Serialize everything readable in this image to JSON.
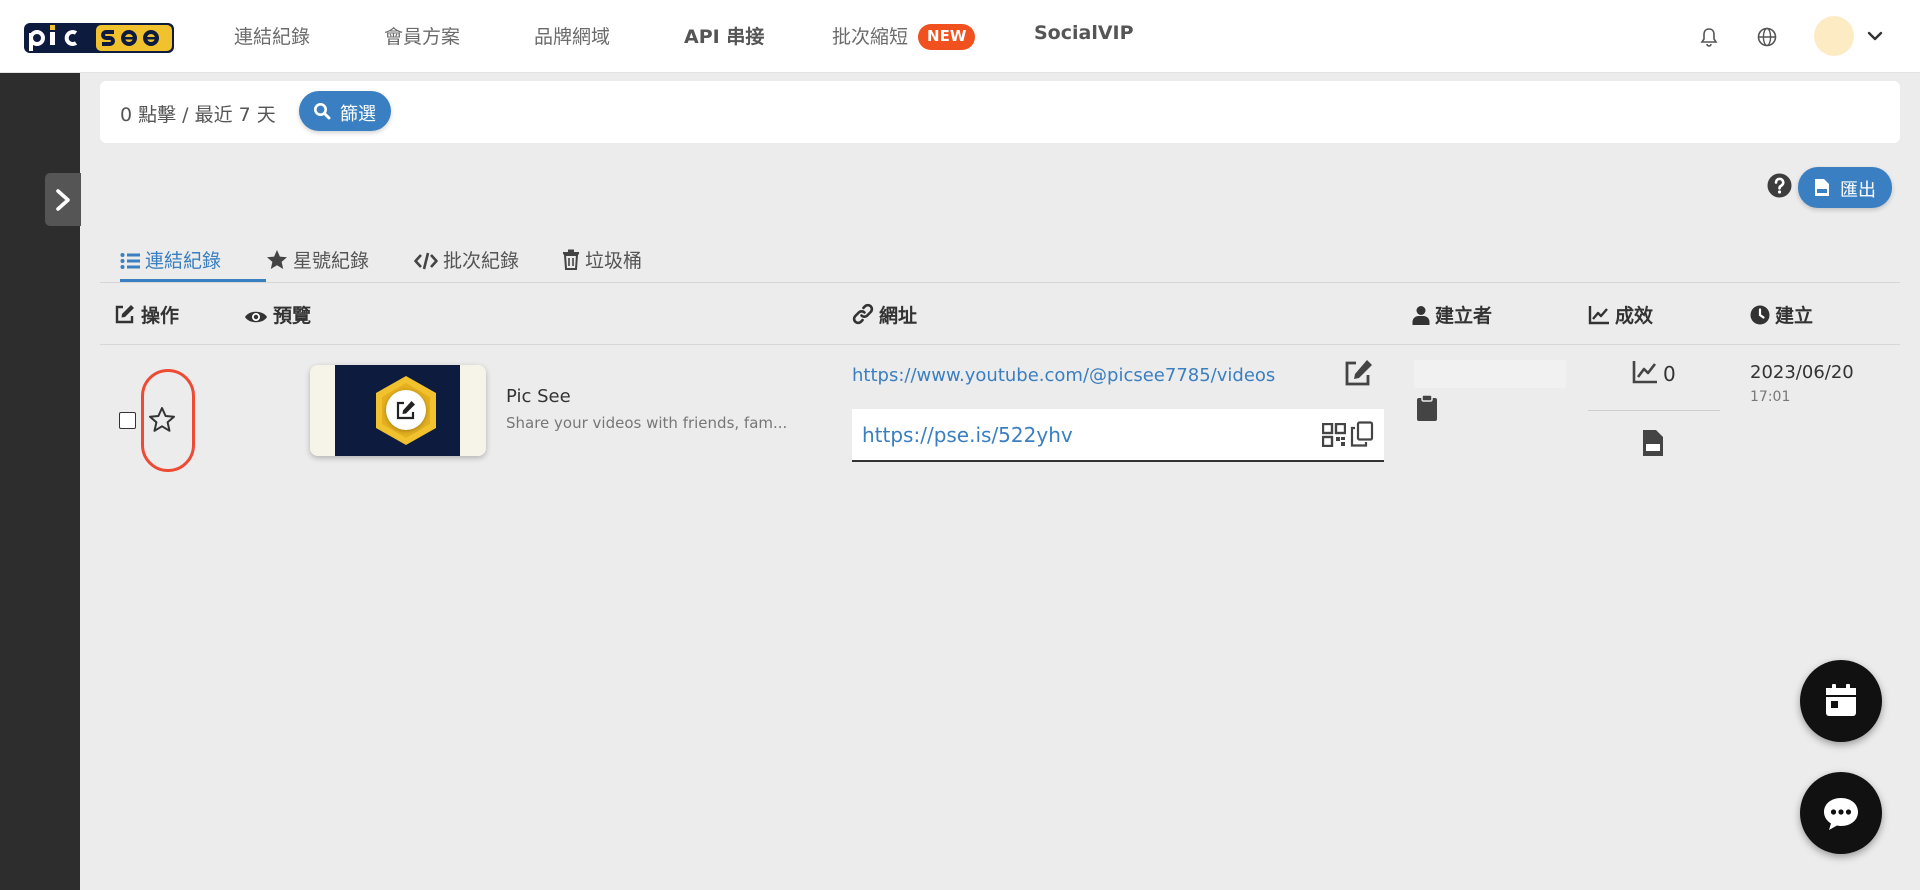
{
  "nav": {
    "links": [
      "連結紀錄",
      "會員方案",
      "品牌網域",
      "API 串接",
      "批次縮短"
    ],
    "badge_new": "NEW",
    "socialvip": "SocialVIP"
  },
  "filter": {
    "summary": "0 點擊 / 最近 7 天",
    "button": "篩選"
  },
  "export_button": "匯出",
  "tabs": [
    "連結紀錄",
    "星號紀錄",
    "批次紀錄",
    "垃圾桶"
  ],
  "columns": {
    "action": "操作",
    "preview": "預覽",
    "url": "網址",
    "creator": "建立者",
    "performance": "成效",
    "created": "建立"
  },
  "row": {
    "title": "Pic See",
    "description": "Share your videos with friends, fam...",
    "original_url": "https://www.youtube.com/@picsee7785/videos",
    "short_url": "https://pse.is/522yhv",
    "clicks": "0",
    "created_date": "2023/06/20",
    "created_time": "17:01"
  },
  "colors": {
    "primary": "#3a7fc1",
    "badge": "#f0511f",
    "highlight": "#ee4b35",
    "logo_navy": "#0d1b3e",
    "logo_gold": "#f2c22e",
    "sidebar": "#2d2d2d"
  }
}
